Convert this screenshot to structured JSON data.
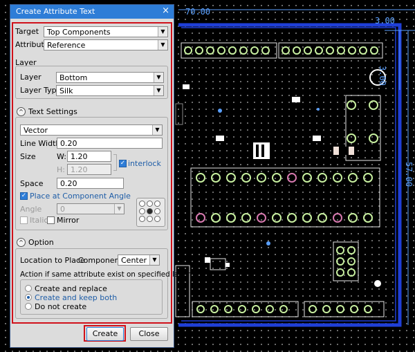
{
  "dialog": {
    "title": "Create Attribute Text",
    "close_glyph": "×",
    "target_label": "Target",
    "target_value": "Top Components",
    "attribute_label": "Attribute",
    "attribute_value": "Reference",
    "layer_section": "Layer",
    "layer_label": "Layer",
    "layer_value": "Bottom",
    "layer_type_label": "Layer Type",
    "layer_type_value": "Silk",
    "text_settings_label": "Text Settings",
    "font_value": "Vector",
    "line_width_label": "Line Width",
    "line_width_value": "0.20",
    "size_label": "Size",
    "w_label": "W:",
    "w_value": "1.20",
    "h_label": "H:",
    "h_value": "1.20",
    "interlock_label": "interlock",
    "space_label": "Space",
    "space_value": "0.20",
    "place_angle_label": "Place at Component Angle",
    "angle_label": "Angle",
    "angle_value": "0",
    "italic_label": "Italic",
    "mirror_label": "Mirror",
    "option_label": "Option",
    "location_label": "Location to Place",
    "components_label": "Component's",
    "location_value": "Center",
    "action_label": "Action if same attribute exist on specified layer",
    "radio_replace": "Create and replace",
    "radio_keep": "Create and keep both",
    "radio_none": "Do not create",
    "create_button": "Create",
    "close_button": "Close"
  },
  "canvas": {
    "dim_top": "70.00",
    "dim_right_small": "3.00",
    "dim_right_mid": "3.00",
    "dim_right_large": "57.00"
  },
  "colors": {
    "title_bar": "#2e7dd7",
    "highlight_red": "#d0101a",
    "board_outline": "#1f3fd8",
    "pad_green": "#c8f0a0",
    "pad_pink": "#d87ab0"
  }
}
